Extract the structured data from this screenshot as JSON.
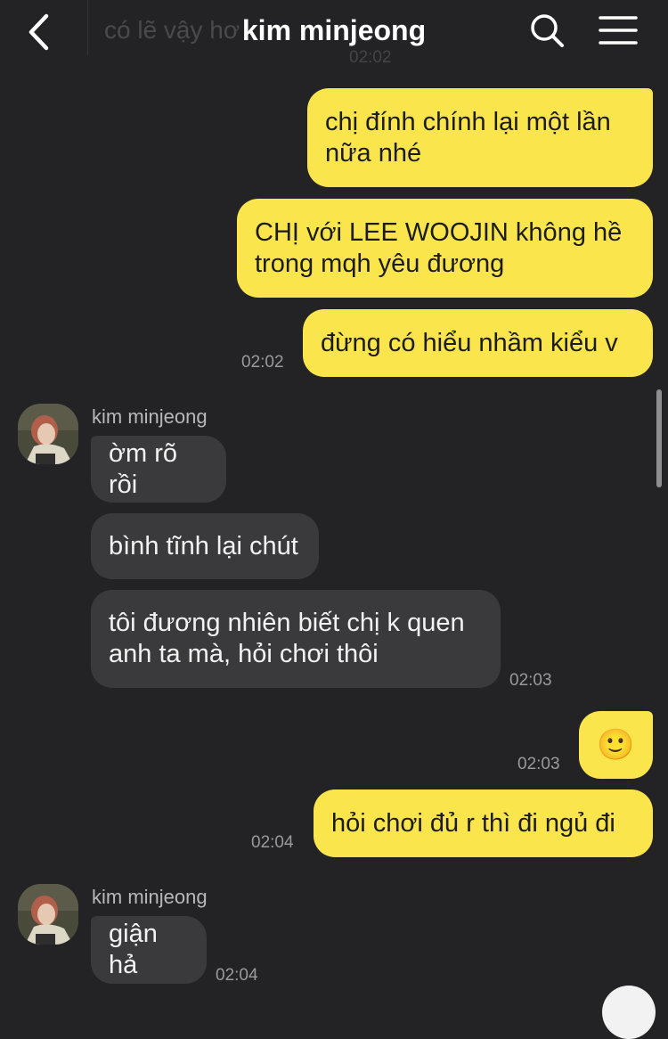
{
  "header": {
    "title": "kim minjeong",
    "ghost_preview_text": "có lẽ vậy hơ",
    "ghost_preview_time": "02:02"
  },
  "messages": [
    {
      "id": "m1",
      "direction": "out",
      "lines": [
        "chị đính chính lại một lần",
        "nữa nhé"
      ]
    },
    {
      "id": "m2",
      "direction": "out",
      "lines": [
        "CHỊ với LEE WOOJIN không hề",
        "trong mqh yêu đương"
      ]
    },
    {
      "id": "m3",
      "direction": "out",
      "lines": [
        "đừng có hiểu nhầm kiểu v"
      ],
      "time": "02:02"
    },
    {
      "id": "m4",
      "direction": "in",
      "sender": "kim minjeong",
      "lines": [
        "ờm rõ rồi"
      ]
    },
    {
      "id": "m5",
      "direction": "in",
      "lines": [
        "bình tĩnh lại chút"
      ]
    },
    {
      "id": "m6",
      "direction": "in",
      "lines": [
        "tôi đương nhiên biết chị k quen",
        "anh ta mà, hỏi chơi thôi"
      ],
      "time": "02:03"
    },
    {
      "id": "m7",
      "direction": "out",
      "emoji": "🙂",
      "time": "02:03"
    },
    {
      "id": "m8",
      "direction": "out",
      "lines": [
        "hỏi chơi đủ r thì đi ngủ đi"
      ],
      "time": "02:04"
    },
    {
      "id": "m9",
      "direction": "in",
      "sender": "kim minjeong",
      "lines": [
        "giận hả"
      ],
      "time": "02:04"
    }
  ],
  "colors": {
    "background": "#232325",
    "outgoing_bubble": "#fbe54d",
    "incoming_bubble": "#3a3a3c",
    "timestamp": "#9a9a9e"
  }
}
